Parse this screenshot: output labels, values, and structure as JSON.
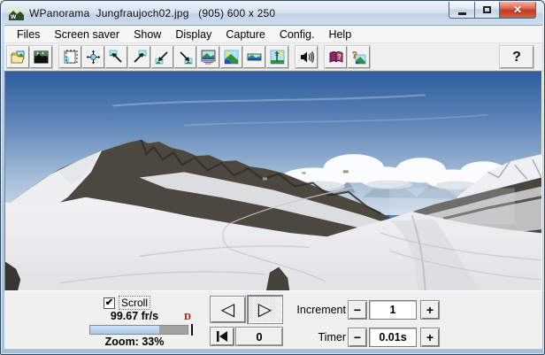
{
  "window": {
    "title": "WPanorama  Jungfraujoch02.jpg   (905) 600 x 250",
    "icon": "wpanorama-logo",
    "close_glyph": "✕"
  },
  "menu": {
    "items": [
      "Files",
      "Screen saver",
      "Show",
      "Display",
      "Capture",
      "Config.",
      "Help"
    ]
  },
  "toolbar": {
    "icons": [
      "open-file",
      "slideshow",
      "frame-select",
      "pan-move",
      "scroll-top-left",
      "scroll-top-right",
      "scroll-bottom-left",
      "scroll-bottom-right",
      "fullscreen-monitor",
      "show-image",
      "panorama-strip",
      "screensaver-scene",
      "sound",
      "help-book",
      "about-image"
    ],
    "help_label": "?"
  },
  "controls": {
    "scroll_label": "Scroll",
    "check_glyph": "✔",
    "framerate": "99.67 fr/s",
    "direction_indicator": "D",
    "progress_percent": 71,
    "zoom_text": "Zoom: 33%",
    "nav": {
      "prev_glyph": "◁",
      "next_glyph": "▷",
      "frame_value": "0"
    },
    "increment": {
      "label": "Increment",
      "value": "1"
    },
    "timer": {
      "label": "Timer",
      "value": "0.01s"
    },
    "minus_glyph": "−",
    "plus_glyph": "+"
  }
}
